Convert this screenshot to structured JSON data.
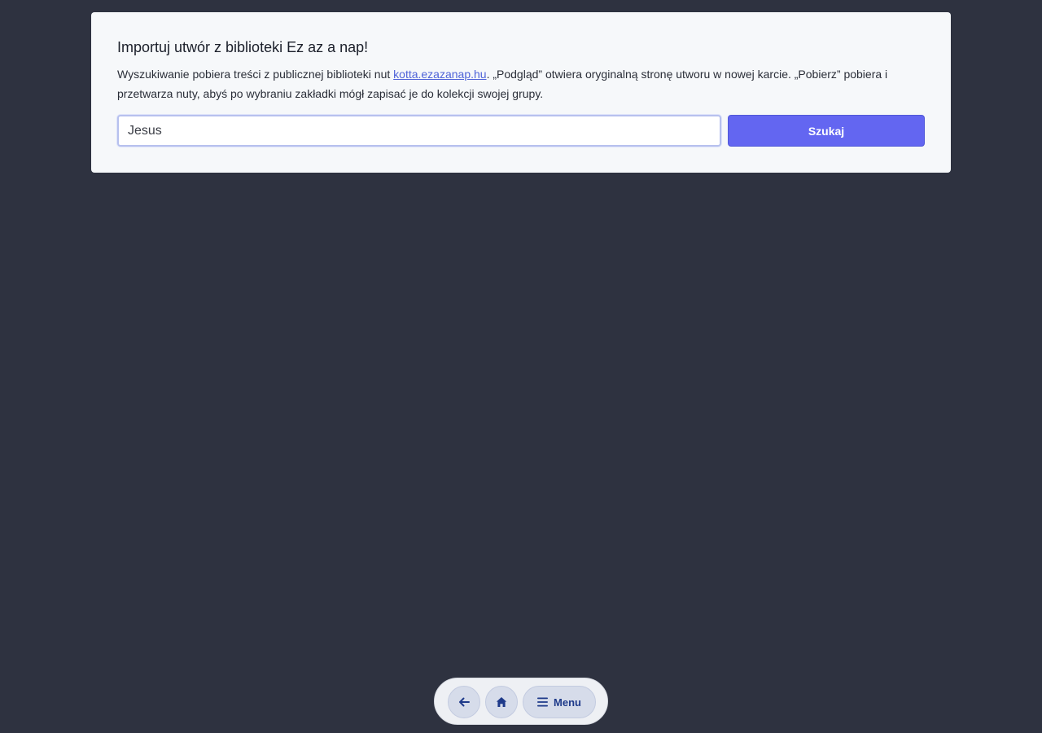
{
  "import_card": {
    "title": "Importuj utwór z biblioteki Ez az a nap!",
    "description_before_link": "Wyszukiwanie pobiera treści z publicznej biblioteki nut ",
    "link_text": "kotta.ezazanap.hu",
    "description_after_link": ". „Podgląd” otwiera oryginalną stronę utworu w nowej karcie. „Pobierz” pobiera i przetwarza nuty, abyś po wybraniu zakładki mógł zapisać je do kolekcji swojej grupy.",
    "search_value": "Jesus",
    "search_button_label": "Szukaj"
  },
  "bottom_nav": {
    "back_icon": "arrow-left-icon",
    "home_icon": "home-icon",
    "menu_icon": "hamburger-menu-icon",
    "menu_label": "Menu"
  },
  "colors": {
    "background": "#2e3240",
    "card": "#f6f8fa",
    "accent": "#6366f1",
    "link": "#4f63d8",
    "nav_icon": "#1e3a8a"
  }
}
